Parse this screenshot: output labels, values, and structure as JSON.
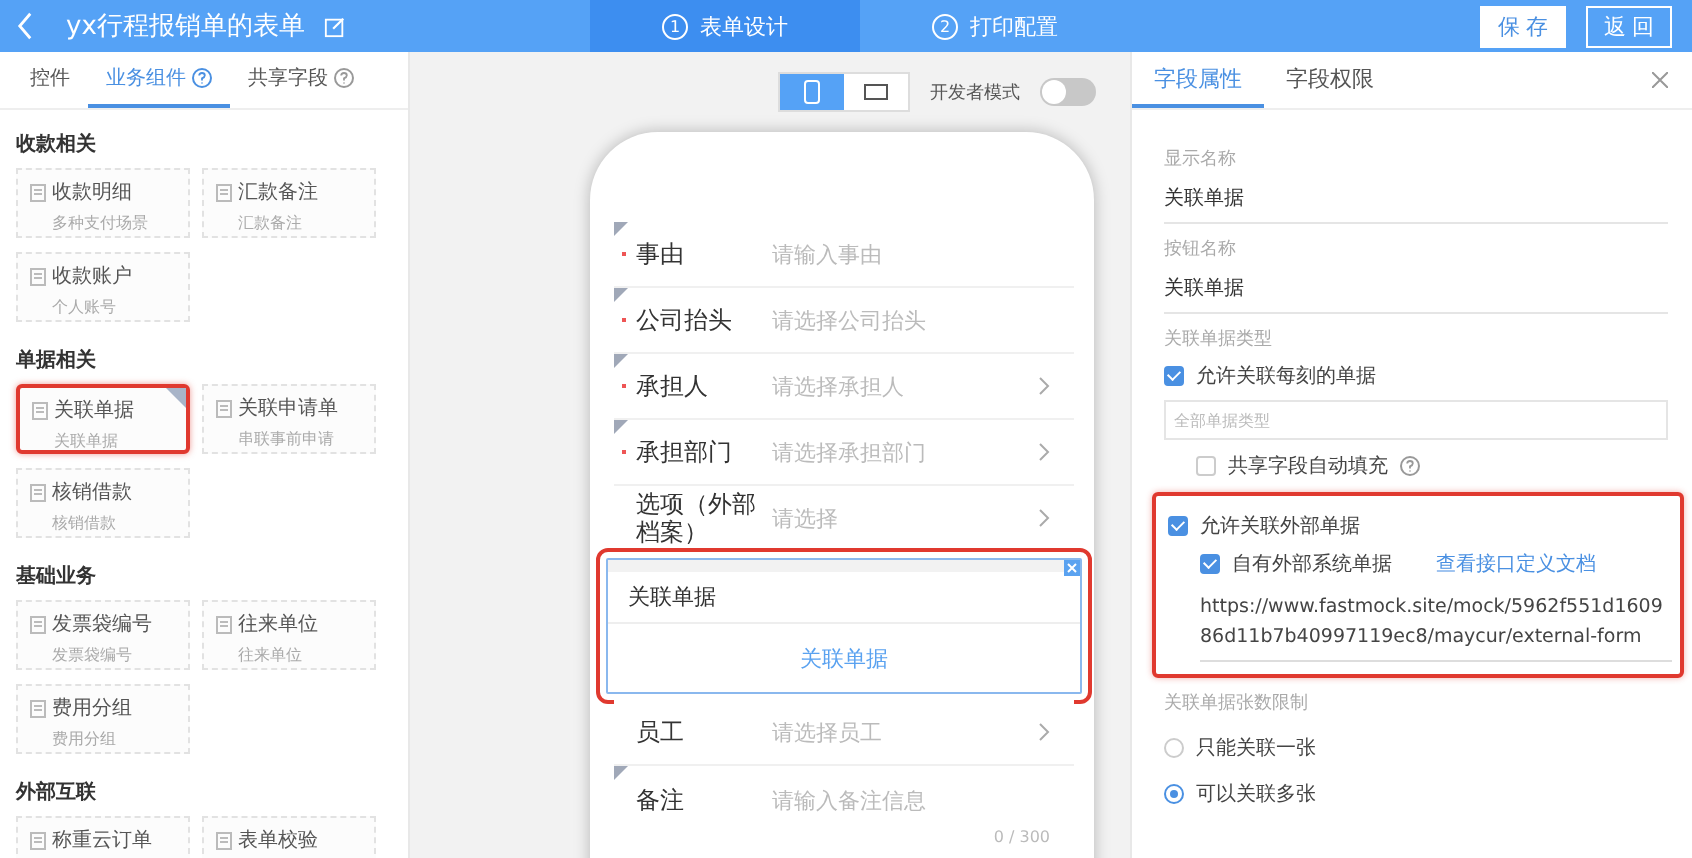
{
  "header": {
    "title": "yx行程报销单的表单",
    "steps": [
      {
        "number": "1",
        "label": "表单设计",
        "selected": true
      },
      {
        "number": "2",
        "label": "打印配置",
        "selected": false
      }
    ],
    "buttons": [
      {
        "label": "保 存",
        "kind": "primary"
      },
      {
        "label": "返 回",
        "kind": "outline"
      }
    ]
  },
  "palette": {
    "tabs": [
      {
        "label": "控件",
        "selected": false,
        "help": false
      },
      {
        "label": "业务组件",
        "selected": true,
        "help": true
      },
      {
        "label": "共享字段",
        "selected": false,
        "help": true
      }
    ],
    "sections": [
      {
        "title": "收款相关",
        "items": [
          {
            "title": "收款明细",
            "subtitle": "多种支付场景",
            "selected": false,
            "highlighted": false
          },
          {
            "title": "汇款备注",
            "subtitle": "汇款备注",
            "selected": false,
            "highlighted": false
          },
          {
            "title": "收款账户",
            "subtitle": "个人账号",
            "selected": false,
            "highlighted": false
          }
        ]
      },
      {
        "title": "单据相关",
        "items": [
          {
            "title": "关联单据",
            "subtitle": "关联单据",
            "selected": true,
            "highlighted": true
          },
          {
            "title": "关联申请单",
            "subtitle": "串联事前申请",
            "selected": false,
            "highlighted": false
          },
          {
            "title": "核销借款",
            "subtitle": "核销借款",
            "selected": false,
            "highlighted": false
          }
        ]
      },
      {
        "title": "基础业务",
        "items": [
          {
            "title": "发票袋编号",
            "subtitle": "发票袋编号",
            "selected": false,
            "highlighted": false
          },
          {
            "title": "往来单位",
            "subtitle": "往来单位",
            "selected": false,
            "highlighted": false
          },
          {
            "title": "费用分组",
            "subtitle": "费用分组",
            "selected": false,
            "highlighted": false
          }
        ]
      },
      {
        "title": "外部互联",
        "items": [
          {
            "title": "称重云订单",
            "selected": false,
            "highlighted": false
          },
          {
            "title": "表单校验",
            "selected": false,
            "highlighted": false
          }
        ]
      }
    ]
  },
  "canvas": {
    "devices": [
      {
        "kind": "phone",
        "selected": true
      },
      {
        "kind": "desktop",
        "selected": false
      }
    ],
    "dev_mode": {
      "label": "开发者模式",
      "on": false
    },
    "fields": [
      {
        "kind": "input",
        "label": "事由",
        "placeholder": "请输入事由",
        "required": true,
        "arrow": false
      },
      {
        "kind": "input",
        "label": "公司抬头",
        "placeholder": "请选择公司抬头",
        "required": true,
        "arrow": false
      },
      {
        "kind": "input",
        "label": "承担人",
        "placeholder": "请选择承担人",
        "required": true,
        "arrow": true
      },
      {
        "kind": "input",
        "label": "承担部门",
        "placeholder": "请选择承担部门",
        "required": true,
        "arrow": true
      },
      {
        "kind": "input",
        "label": "选项（外部档案）",
        "placeholder": "请选择",
        "required": false,
        "arrow": true
      },
      {
        "kind": "related",
        "label": "关联单据",
        "button": "关联单据",
        "selected": true,
        "highlighted": true
      },
      {
        "kind": "input",
        "label": "员工",
        "placeholder": "请选择员工",
        "required": false,
        "arrow": true
      },
      {
        "kind": "textarea",
        "label": "备注",
        "placeholder": "请输入备注信息",
        "counter": "0 / 300",
        "required": false
      }
    ]
  },
  "properties": {
    "tabs": [
      {
        "label": "字段属性",
        "selected": true
      },
      {
        "label": "字段权限",
        "selected": false
      }
    ],
    "display_name": {
      "label": "显示名称",
      "value": "关联单据"
    },
    "button_name": {
      "label": "按钮名称",
      "value": "关联单据"
    },
    "type_label": "关联单据类型",
    "allow_any": {
      "label": "允许关联每刻的单据",
      "checked": true
    },
    "type_select": {
      "placeholder": "全部单据类型"
    },
    "shared_autofill": {
      "label": "共享字段自动填充",
      "checked": false
    },
    "external": {
      "highlighted": true,
      "allow": {
        "label": "允许关联外部单据",
        "checked": true
      },
      "own": {
        "label": "自有外部系统单据",
        "checked": true
      },
      "doc_link": "查看接口定义文档",
      "url": "https://www.fastmock.site/mock/5962f551d160986d11b7b40997119ec8/maycur/external-form"
    },
    "limit_label": "关联单据张数限制",
    "limits": [
      {
        "label": "只能关联一张",
        "selected": false
      },
      {
        "label": "可以关联多张",
        "selected": true
      }
    ]
  }
}
